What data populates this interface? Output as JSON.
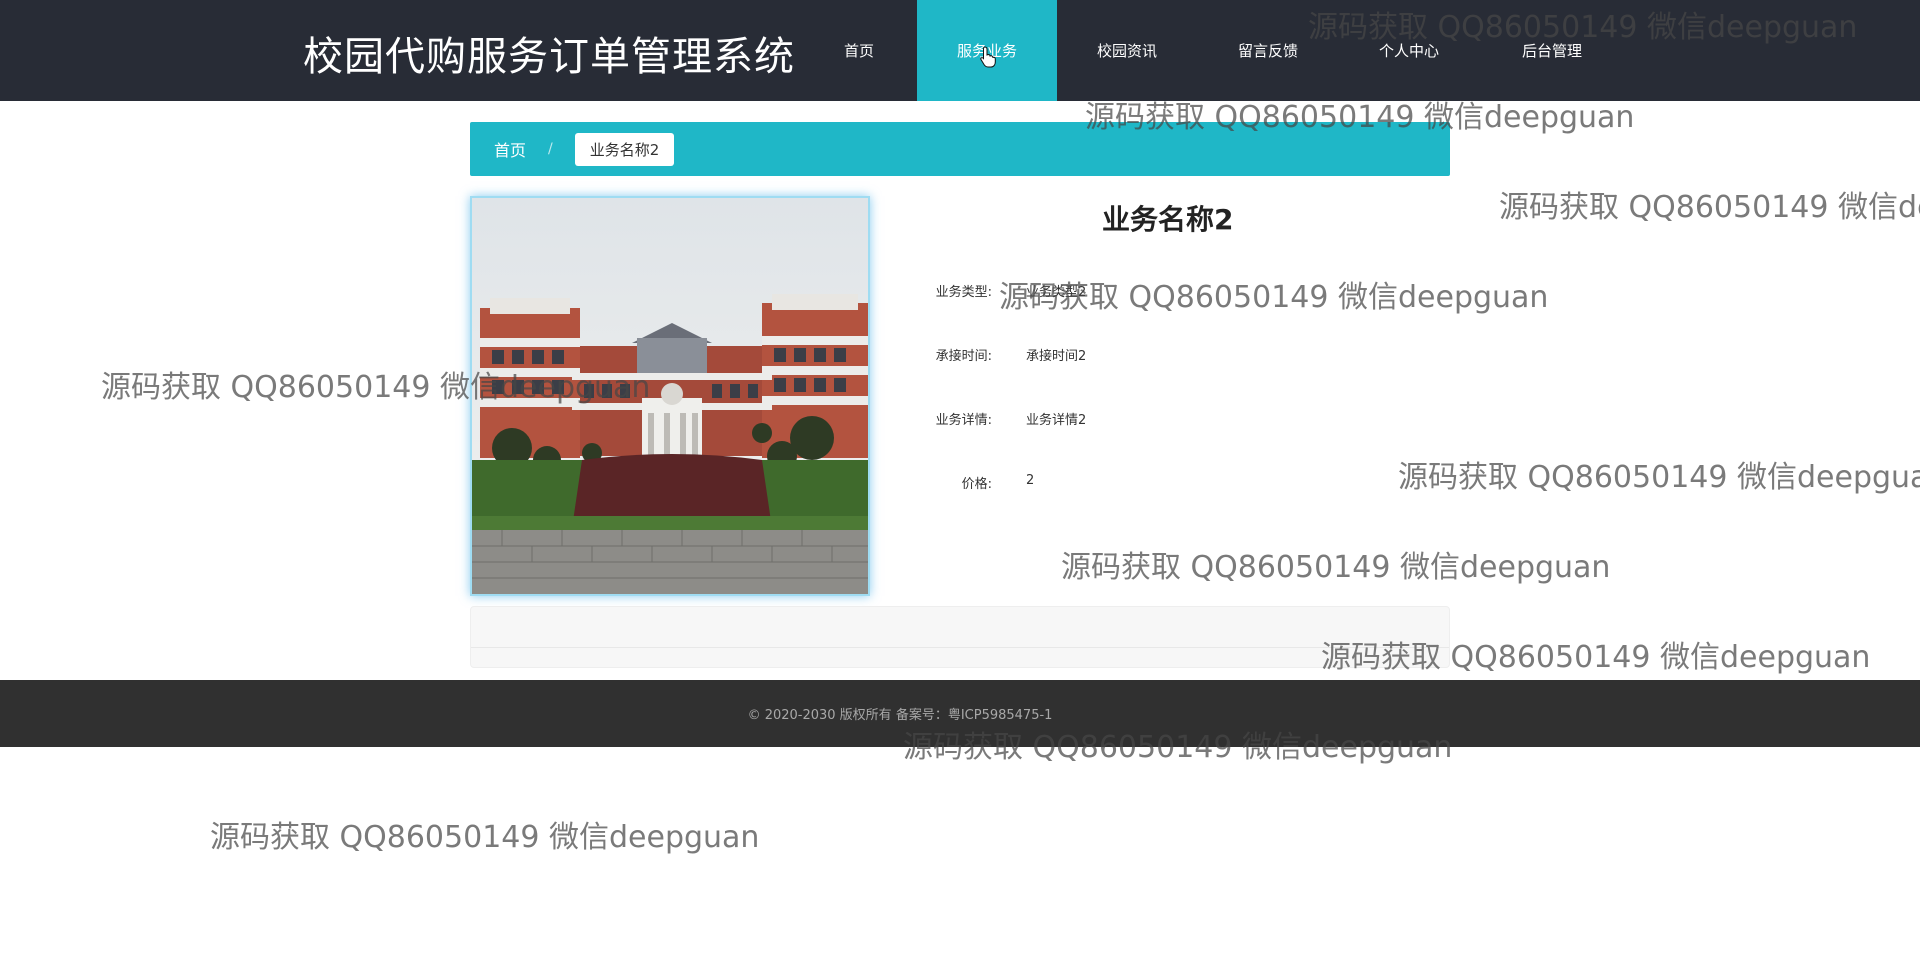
{
  "header": {
    "site_title": "校园代购服务订单管理系统",
    "nav": [
      {
        "label": "首页"
      },
      {
        "label": "服务业务",
        "active": true
      },
      {
        "label": "校园资讯"
      },
      {
        "label": "留言反馈"
      },
      {
        "label": "个人中心"
      },
      {
        "label": "后台管理"
      }
    ]
  },
  "breadcrumb": {
    "home": "首页",
    "separator": "/",
    "current": "业务名称2"
  },
  "detail": {
    "title": "业务名称2",
    "fields": [
      {
        "label": "业务类型:",
        "value": "业务类型2"
      },
      {
        "label": "承接时间:",
        "value": "承接时间2"
      },
      {
        "label": "业务详情:",
        "value": "业务详情2"
      },
      {
        "label": "价格:",
        "value": "2"
      }
    ]
  },
  "footer": {
    "copyright": "© 2020-2030 版权所有 备案号：粤ICP5985475-1"
  },
  "watermark": {
    "text": "源码获取 QQ86050149 微信deepguan"
  },
  "colors": {
    "header_bg": "#282c36",
    "accent": "#1fb7c7",
    "footer_bg": "#303030"
  }
}
